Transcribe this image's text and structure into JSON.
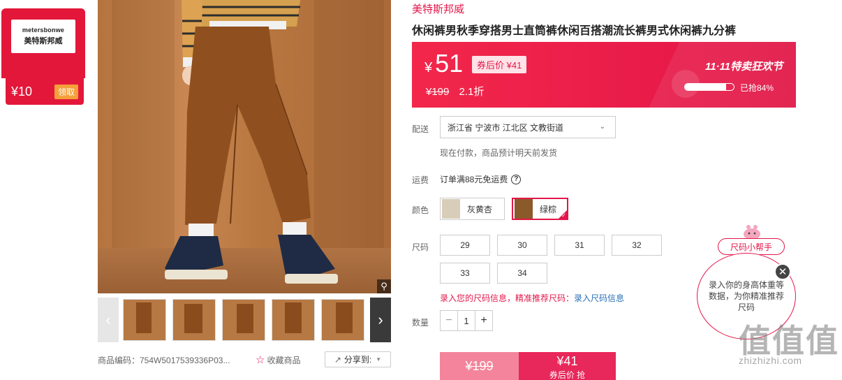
{
  "coupon": {
    "logo_en": "metersbonwe",
    "logo_cn": "美特斯邦威",
    "amount": "¥10",
    "get_label": "领取"
  },
  "gallery": {
    "zoom_icon": "magnifier-icon",
    "prev_icon": "chevron-left-icon",
    "next_icon": "chevron-right-icon",
    "thumb_count": 6
  },
  "meta": {
    "code": "商品编码：754W5017539336P03...",
    "favorite_label": "收藏商品",
    "share_label": "分享到:"
  },
  "product": {
    "brand": "美特斯邦威",
    "title": "休闲裤男秋季穿搭男士直筒裤休闲百搭潮流长裤男式休闲裤九分裤"
  },
  "price": {
    "yen": "¥",
    "current": "51",
    "after_coupon": "券后价 ¥41",
    "original": "¥199",
    "discount": "2.1折",
    "festival": "11·11特卖狂欢节",
    "sold_text": "已抢84%",
    "sold_fraction": 0.84
  },
  "delivery": {
    "label": "配送",
    "address": "浙江省 宁波市 江北区 文教街道",
    "note": "现在付款，商品预计明天前发货"
  },
  "freight": {
    "label": "运费",
    "text": "订单满88元免运费"
  },
  "color": {
    "label": "颜色",
    "options": [
      {
        "label": "灰黄杏",
        "swatch": "#d8cdb8"
      },
      {
        "label": "绿棕",
        "swatch": "#8a5a2b"
      }
    ],
    "selected": "绿棕"
  },
  "size": {
    "label": "尺码",
    "options": [
      "29",
      "30",
      "31",
      "32",
      "33",
      "34"
    ],
    "hint_red": "录入您的尺码信息，精准推荐尺码：",
    "hint_link": "录入尺码信息"
  },
  "quantity": {
    "label": "数量",
    "value": "1",
    "minus": "−",
    "plus": "+"
  },
  "buy": {
    "original": "¥199",
    "price": "¥41",
    "sub": "券后价 抢"
  },
  "helper": {
    "tag": "尺码小帮手",
    "bubble": "录入你的身高体重等数据，为你精准推荐尺码",
    "close": "✕"
  },
  "watermark": {
    "main": "值值值",
    "sub": "zhizhizhi.com"
  },
  "colors": {
    "accent": "#e3174a",
    "price_bg": "#f2274a"
  }
}
